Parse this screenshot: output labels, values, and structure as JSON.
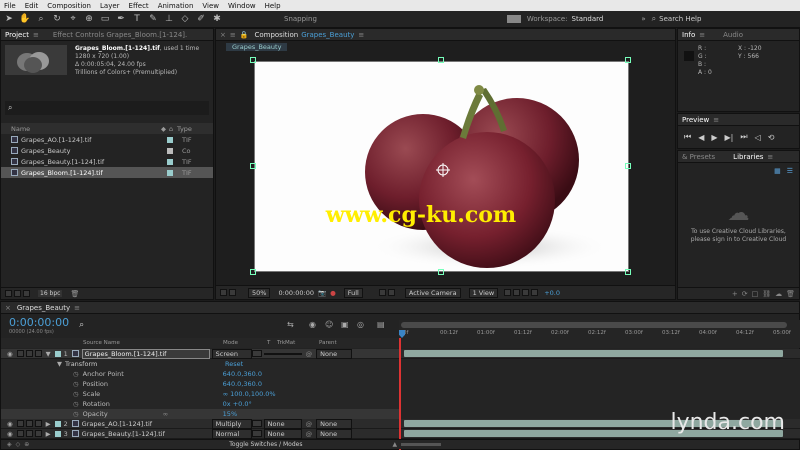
{
  "menu": [
    "File",
    "Edit",
    "Composition",
    "Layer",
    "Effect",
    "Animation",
    "View",
    "Window",
    "Help"
  ],
  "toolbar": {
    "snapping_label": "Snapping",
    "workspace_label": "Workspace:",
    "workspace_value": "Standard",
    "search_help": "Search Help"
  },
  "project_panel": {
    "tab_project": "Project",
    "tab_effect_controls": "Effect Controls Grapes_Bloom.[1-124].",
    "selected_name": "Grapes_Bloom.[1-124].tif",
    "used_count": ", used 1 time",
    "dimensions": "1280 x 720 (1.00)",
    "duration": "Δ 0:00:05:04, 24.00 fps",
    "colors": "Trillions of Colors+ (Premultiplied)",
    "search_placeholder": "",
    "col_name": "Name",
    "col_type": "Type",
    "items": [
      {
        "name": "Grapes_AO.[1-124].tif",
        "type": "TIF"
      },
      {
        "name": "Grapes_Beauty",
        "type": "Co"
      },
      {
        "name": "Grapes_Beauty.[1-124].tif",
        "type": "TIF"
      },
      {
        "name": "Grapes_Bloom.[1-124].tif",
        "type": "TIF"
      }
    ],
    "bpc": "16 bpc"
  },
  "composition_panel": {
    "tab_label": "Composition",
    "comp_name": "Grapes_Beauty",
    "sub_tab": "Grapes_Beauty",
    "watermark": "www.cg-ku.com",
    "zoom": "50%",
    "timecode": "0:00:00:00",
    "resolution": "Full",
    "camera": "Active Camera",
    "view": "1 View",
    "offset": "+0.0"
  },
  "info_panel": {
    "tab_info": "Info",
    "tab_audio": "Audio",
    "r": "R :",
    "g": "G :",
    "b": "B :",
    "a": "A :  0",
    "x": "X : -120",
    "y": "Y : 566"
  },
  "preview_panel": {
    "tab": "Preview"
  },
  "libraries_panel": {
    "tab_presets": "& Presets",
    "tab_libraries": "Libraries",
    "message": "To use Creative Cloud Libraries, please sign in to Creative Cloud"
  },
  "timeline": {
    "comp_tab": "Grapes_Beauty",
    "timecode": "0:00:00:00",
    "fps": "00000 (24.00 fps)",
    "col_source": "Source Name",
    "col_mode": "Mode",
    "col_t": "T",
    "col_trkmat": "TrkMat",
    "col_parent": "Parent",
    "ruler": [
      "0f",
      "00:12f",
      "01:00f",
      "01:12f",
      "02:00f",
      "02:12f",
      "03:00f",
      "03:12f",
      "04:00f",
      "04:12f",
      "05:00f"
    ],
    "layers": [
      {
        "num": "1",
        "name": "Grapes_Bloom.[1-124].tif",
        "mode": "Screen",
        "trkmat": "",
        "parent": "None"
      },
      {
        "num": "2",
        "name": "Grapes_AO.[1-124].tif",
        "mode": "Multiply",
        "trkmat": "None",
        "parent": "None"
      },
      {
        "num": "3",
        "name": "Grapes_Beauty.[1-124].tif",
        "mode": "Normal",
        "trkmat": "None",
        "parent": "None"
      }
    ],
    "transform_label": "Transform",
    "reset_label": "Reset",
    "properties": [
      {
        "name": "Anchor Point",
        "value": "640.0,360.0"
      },
      {
        "name": "Position",
        "value": "640.0,360.0"
      },
      {
        "name": "Scale",
        "value": "∞ 100.0,100.0%"
      },
      {
        "name": "Rotation",
        "value": "0x +0.0°"
      },
      {
        "name": "Opacity",
        "value": "15%"
      }
    ],
    "toggle_label": "Toggle Switches / Modes",
    "lynda": "lynda.com"
  }
}
